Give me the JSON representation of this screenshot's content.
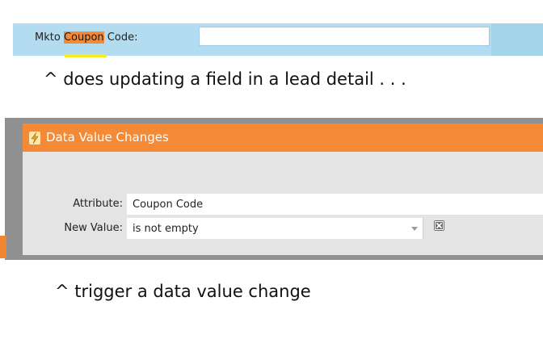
{
  "lead_detail": {
    "label_prefix": "Mkto ",
    "label_highlight": "Coupon",
    "label_suffix": " Code:",
    "field_value": "",
    "highlight_color": "#f4893a",
    "underline_color": "#f3ef1a",
    "strip_color": "#b3dcf0"
  },
  "captions": {
    "first": "^ does updating a field in a lead detail . . .",
    "second": "^ trigger a data value change"
  },
  "trigger": {
    "title": "Data Value Changes",
    "icon": "lightning-bolt-icon",
    "header_color": "#f48a36",
    "attribute_label": "Attribute:",
    "attribute_value": "Coupon Code",
    "new_value_label": "New Value:",
    "new_value_selected": "is not empty",
    "remove_icon": "remove-x-icon"
  }
}
